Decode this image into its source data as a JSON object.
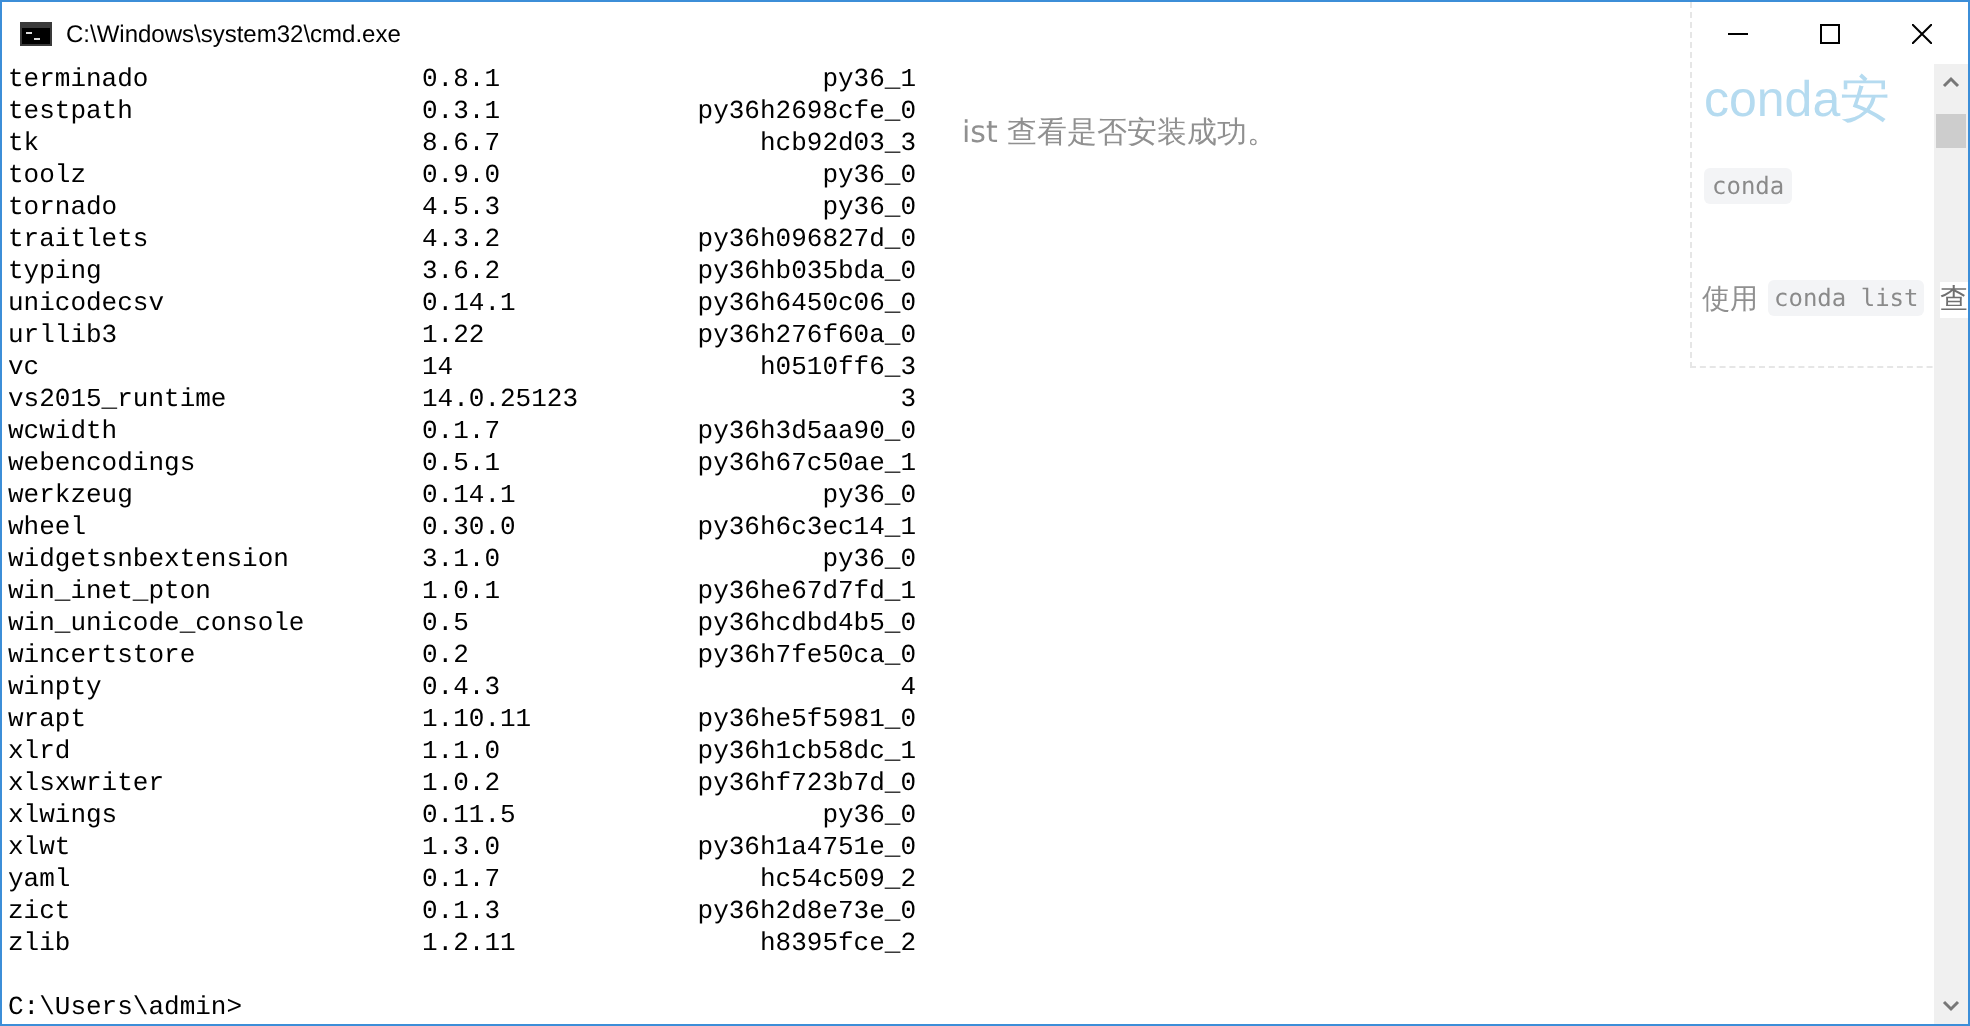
{
  "window": {
    "title": "C:\\Windows\\system32\\cmd.exe"
  },
  "rows": [
    {
      "name": "terminado",
      "version": "0.8.1",
      "build": "py36_1"
    },
    {
      "name": "testpath",
      "version": "0.3.1",
      "build": "py36h2698cfe_0"
    },
    {
      "name": "tk",
      "version": "8.6.7",
      "build": "hcb92d03_3"
    },
    {
      "name": "toolz",
      "version": "0.9.0",
      "build": "py36_0"
    },
    {
      "name": "tornado",
      "version": "4.5.3",
      "build": "py36_0"
    },
    {
      "name": "traitlets",
      "version": "4.3.2",
      "build": "py36h096827d_0"
    },
    {
      "name": "typing",
      "version": "3.6.2",
      "build": "py36hb035bda_0"
    },
    {
      "name": "unicodecsv",
      "version": "0.14.1",
      "build": "py36h6450c06_0"
    },
    {
      "name": "urllib3",
      "version": "1.22",
      "build": "py36h276f60a_0"
    },
    {
      "name": "vc",
      "version": "14",
      "build": "h0510ff6_3"
    },
    {
      "name": "vs2015_runtime",
      "version": "14.0.25123",
      "build": "3"
    },
    {
      "name": "wcwidth",
      "version": "0.1.7",
      "build": "py36h3d5aa90_0"
    },
    {
      "name": "webencodings",
      "version": "0.5.1",
      "build": "py36h67c50ae_1"
    },
    {
      "name": "werkzeug",
      "version": "0.14.1",
      "build": "py36_0"
    },
    {
      "name": "wheel",
      "version": "0.30.0",
      "build": "py36h6c3ec14_1"
    },
    {
      "name": "widgetsnbextension",
      "version": "3.1.0",
      "build": "py36_0"
    },
    {
      "name": "win_inet_pton",
      "version": "1.0.1",
      "build": "py36he67d7fd_1"
    },
    {
      "name": "win_unicode_console",
      "version": "0.5",
      "build": "py36hcdbd4b5_0"
    },
    {
      "name": "wincertstore",
      "version": "0.2",
      "build": "py36h7fe50ca_0"
    },
    {
      "name": "winpty",
      "version": "0.4.3",
      "build": "4"
    },
    {
      "name": "wrapt",
      "version": "1.10.11",
      "build": "py36he5f5981_0"
    },
    {
      "name": "xlrd",
      "version": "1.1.0",
      "build": "py36h1cb58dc_1"
    },
    {
      "name": "xlsxwriter",
      "version": "1.0.2",
      "build": "py36hf723b7d_0"
    },
    {
      "name": "xlwings",
      "version": "0.11.5",
      "build": "py36_0"
    },
    {
      "name": "xlwt",
      "version": "1.3.0",
      "build": "py36h1a4751e_0"
    },
    {
      "name": "yaml",
      "version": "0.1.7",
      "build": "hc54c509_2"
    },
    {
      "name": "zict",
      "version": "0.1.3",
      "build": "py36h2d8e73e_0"
    },
    {
      "name": "zlib",
      "version": "1.2.11",
      "build": "h8395fce_2"
    }
  ],
  "prompt": "C:\\Users\\admin>",
  "background_page": {
    "heading": "conda安",
    "note": "ist 查看是否安装成功。",
    "chip": "conda",
    "usage_prefix": "使用",
    "usage_code": "conda list",
    "usage_suffix": "查"
  }
}
